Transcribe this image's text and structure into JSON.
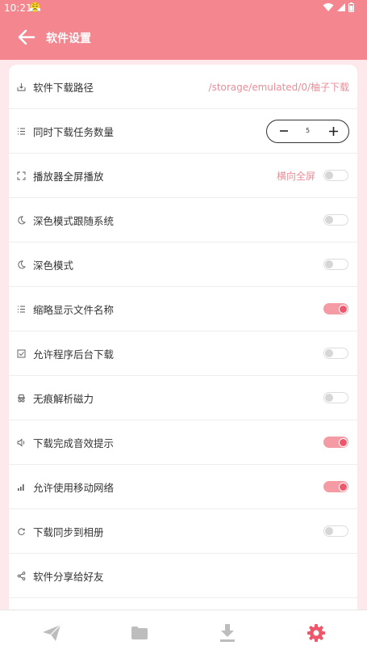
{
  "status_bar": {
    "time": "10:21",
    "emoji": "😤"
  },
  "header": {
    "title": "软件设置"
  },
  "settings": {
    "download_path": {
      "label": "软件下载路径",
      "value": "/storage/emulated/0/柚子下载"
    },
    "concurrent_tasks": {
      "label": "同时下载任务数量",
      "value": "5"
    },
    "player_fullscreen": {
      "label": "播放器全屏播放",
      "mode": "横向全屏",
      "enabled": false
    },
    "dark_follow_system": {
      "label": "深色模式跟随系统",
      "enabled": false
    },
    "dark_mode": {
      "label": "深色模式",
      "enabled": false
    },
    "short_file_name": {
      "label": "缩略显示文件名称",
      "enabled": true
    },
    "background_download": {
      "label": "允许程序后台下载",
      "enabled": false
    },
    "incognito_magnet": {
      "label": "无痕解析磁力",
      "enabled": false
    },
    "complete_sound": {
      "label": "下载完成音效提示",
      "enabled": true
    },
    "mobile_network": {
      "label": "允许使用移动网络",
      "enabled": true
    },
    "sync_album": {
      "label": "下载同步到相册",
      "enabled": false
    },
    "share_app": {
      "label": "软件分享给好友"
    }
  },
  "colors": {
    "accent": "#f3868f",
    "toggle_on": "#f0566a",
    "value_text": "#e98e98"
  },
  "bottom_nav": {
    "items": [
      {
        "icon": "paper-plane-icon",
        "active": false
      },
      {
        "icon": "folder-icon",
        "active": false
      },
      {
        "icon": "download-icon",
        "active": false
      },
      {
        "icon": "gear-icon",
        "active": true
      }
    ]
  }
}
